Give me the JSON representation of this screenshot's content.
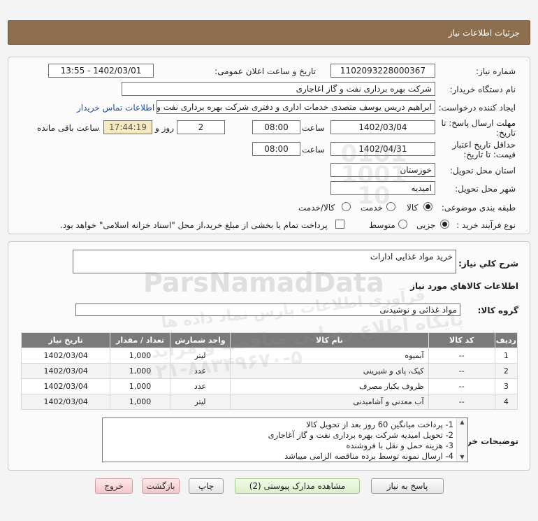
{
  "header": {
    "title": "جزئیات اطلاعات نیاز"
  },
  "fields": {
    "need_number_label": "شماره نیاز:",
    "need_number": "1102093228000367",
    "announce_label": "تاریخ و ساعت اعلان عمومی:",
    "announce_value": "1402/03/01 - 13:55",
    "buyer_org_label": "نام دستگاه خریدار:",
    "buyer_org": "شرکت بهره برداری نفت و گاز اغاجاری",
    "creator_label": "ایجاد کننده درخواست:",
    "creator": "ابراهیم دریس یوسف متصدی خدمات اداری و دفتری شرکت بهره برداری نفت و گاز",
    "contact_link": "اطلاعات تماس خریدار",
    "deadline_label_1": "مهلت ارسال پاسخ: تا",
    "deadline_label_2": "تاریخ:",
    "deadline_date": "1402/03/04",
    "time_label": "ساعت",
    "deadline_time": "08:00",
    "days_value": "2",
    "days_label": "روز و",
    "remaining_time": "17:44:19",
    "remaining_label": "ساعت باقی مانده",
    "validity_label_1": "حداقل تاریخ اعتبار",
    "validity_label_2": "قیمت: تا تاریخ:",
    "validity_date": "1402/04/31",
    "validity_time": "08:00",
    "province_label": "استان محل تحویل:",
    "province": "خوزستان",
    "city_label": "شهر محل تحویل:",
    "city": "امیدیه",
    "category_label": "طبقه بندی موضوعی:",
    "category_options": [
      "کالا",
      "خدمت",
      "کالا/خدمت"
    ],
    "process_label": "نوع فرآیند خرید :",
    "process_options": [
      "جزیی",
      "متوسط"
    ],
    "payment_note": "پرداخت تمام یا بخشی از مبلغ خرید،از محل \"اسناد خزانه اسلامی\" خواهد بود."
  },
  "summary": {
    "label": "شرح کلي نياز:",
    "value": "خرید مواد غذایی ادارات"
  },
  "goods_section": {
    "title": "اطلاعات کالاهاي مورد نياز",
    "group_label": "گروه کالا:",
    "group_value": "مواد غذائی و نوشیدنی"
  },
  "table": {
    "headers": [
      "ردیف",
      "کد کالا",
      "نام کالا",
      "واحد شمارش",
      "تعداد / مقدار",
      "تاریخ نیاز"
    ],
    "rows": [
      [
        "1",
        "--",
        "آبمیوه",
        "لیتر",
        "1,000",
        "1402/03/04"
      ],
      [
        "2",
        "--",
        "کیک، پای و شیرینی",
        "عدد",
        "1,000",
        "1402/03/04"
      ],
      [
        "3",
        "--",
        "ظروف یکبار مصرف",
        "عدد",
        "1,000",
        "1402/03/04"
      ],
      [
        "4",
        "--",
        "آب معدنی و آشامیدنی",
        "لیتر",
        "1,000",
        "1402/03/04"
      ]
    ]
  },
  "notes": {
    "label": "توضیحات خریدار:",
    "lines": [
      "1- پرداخت میانگین 60 روز بعد از تحویل کالا",
      "2- تحویل امیدیه شرکت بهره برداری نفت و گاز آغاجاری",
      "3- هزینه حمل و نقل با فروشنده",
      "4- ارسال نمونه توسط برده مناقصه الزامی میباشد"
    ]
  },
  "buttons": {
    "reply": "پاسخ به نیاز",
    "attachments": "مشاهده مدارک پیوستی (2)",
    "print": "چاپ",
    "back": "بازگشت",
    "exit": "خروج"
  },
  "watermark": {
    "brand": "ParsNamadData",
    "line1": "فرآوری اطلاعات پارس نماد داده ها",
    "line2": "پایگاه اطلاع رسانی مناقصه و مزایده",
    "phone": "۰۲۱-۸۸۳۴۹۶۷۰-۵",
    "stamp": "0101 1001 10"
  }
}
